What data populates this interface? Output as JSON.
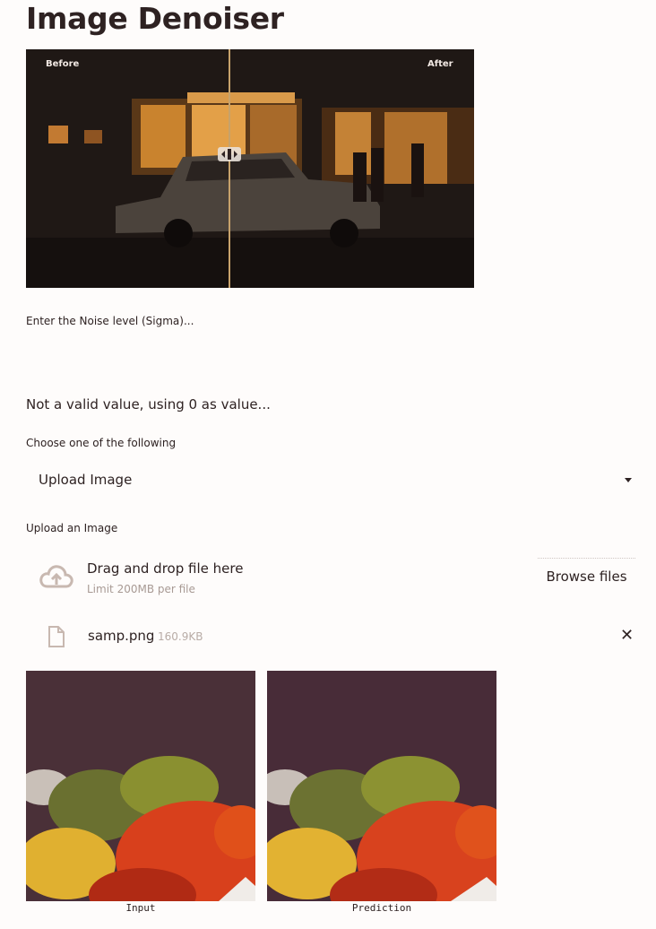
{
  "title": "Image Denoiser",
  "comparison": {
    "before_label": "Before",
    "after_label": "After"
  },
  "noise": {
    "label": "Enter the Noise level (Sigma)...",
    "message": "Not a valid value, using 0 as value..."
  },
  "source": {
    "label": "Choose one of the following",
    "selected": "Upload Image"
  },
  "uploader": {
    "label": "Upload an Image",
    "drop_text": "Drag and drop file here",
    "limit_text": "Limit 200MB per file",
    "browse_label": "Browse files"
  },
  "file": {
    "name": "samp.png",
    "size": "160.9KB"
  },
  "results": {
    "input_caption": "Input",
    "prediction_caption": "Prediction"
  }
}
